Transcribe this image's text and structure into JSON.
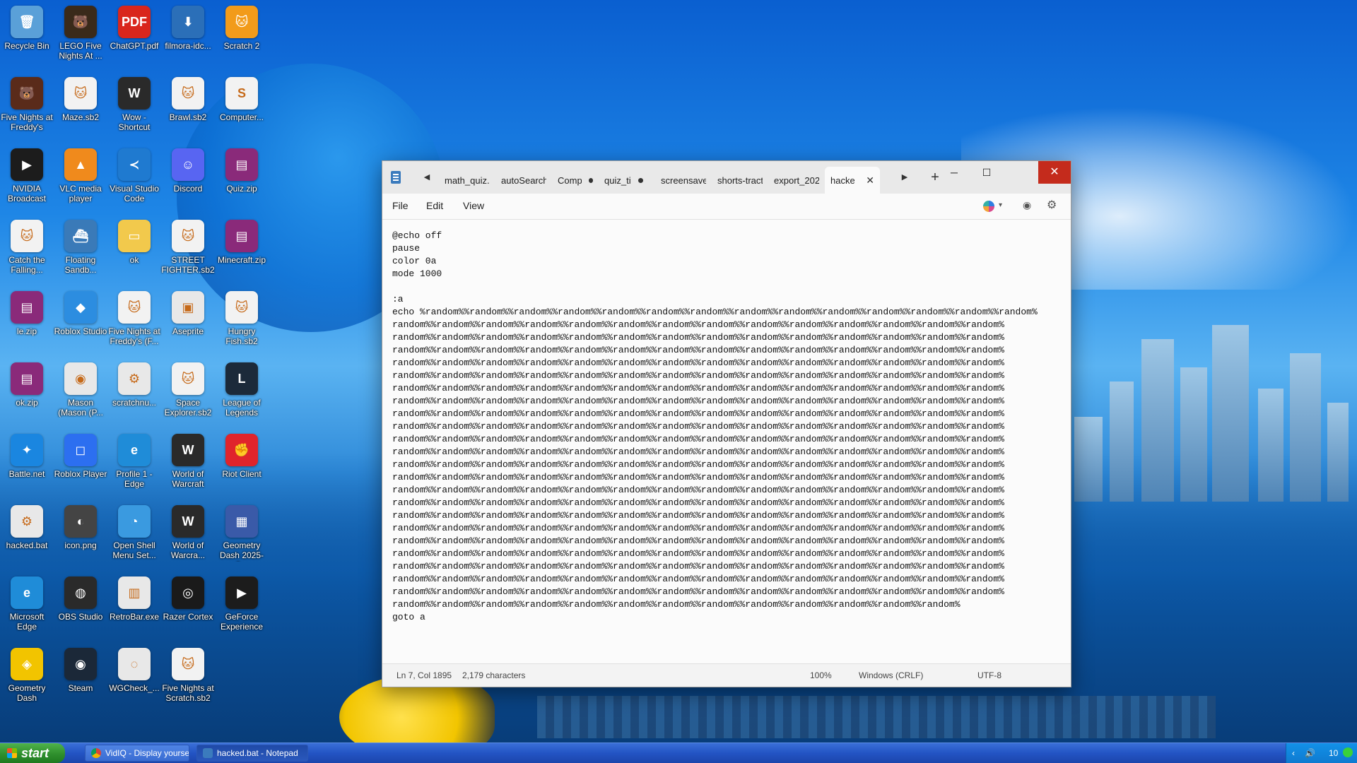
{
  "desktop": {
    "icons": [
      {
        "label": "Recycle Bin",
        "icon": "recycle-bin-icon",
        "color": "#5aa0d8",
        "glyph": "🗑"
      },
      {
        "label": "LEGO Five Nights At ...",
        "icon": "lego-fnaf-icon",
        "color": "#3a2a1a",
        "glyph": "🐻"
      },
      {
        "label": "ChatGPT.pdf",
        "icon": "pdf-file-icon",
        "color": "#d9261c",
        "glyph": "PDF"
      },
      {
        "label": "filmora-idc...",
        "icon": "installer-icon",
        "color": "#2b6fb8",
        "glyph": "⬇"
      },
      {
        "label": "Scratch 2",
        "icon": "scratch-cat-icon",
        "color": "#f29b1a",
        "glyph": "🐱"
      },
      {
        "label": "Five Nights at Freddy's",
        "icon": "fnaf-icon",
        "color": "#5a2b1a",
        "glyph": "🐻"
      },
      {
        "label": "Maze.sb2",
        "icon": "scratch-file-icon",
        "color": "#f2f2f2",
        "glyph": "🐱"
      },
      {
        "label": "Wow - Shortcut",
        "icon": "wow-icon",
        "color": "#2a2a2a",
        "glyph": "W"
      },
      {
        "label": "Brawl.sb2",
        "icon": "scratch-file-icon",
        "color": "#f2f2f2",
        "glyph": "🐱"
      },
      {
        "label": "Computer...",
        "icon": "computer-file-icon",
        "color": "#f2f2f2",
        "glyph": "S"
      },
      {
        "label": "NVIDIA Broadcast",
        "icon": "nvidia-broadcast-icon",
        "color": "#1c1c1c",
        "glyph": "▶"
      },
      {
        "label": "VLC media player",
        "icon": "vlc-icon",
        "color": "#f08a1c",
        "glyph": "▲"
      },
      {
        "label": "Visual Studio Code",
        "icon": "vscode-icon",
        "color": "#1f7ad0",
        "glyph": "≺"
      },
      {
        "label": "Discord",
        "icon": "discord-icon",
        "color": "#5865f2",
        "glyph": "☺"
      },
      {
        "label": "Quiz.zip",
        "icon": "winrar-icon",
        "color": "#8a2a7a",
        "glyph": "▤"
      },
      {
        "label": "Catch the Falling...",
        "icon": "scratch-file-icon",
        "color": "#f2f2f2",
        "glyph": "🐱"
      },
      {
        "label": "Floating Sandb...",
        "icon": "boat-icon",
        "color": "#3a7ab8",
        "glyph": "⛴"
      },
      {
        "label": "ok",
        "icon": "folder-icon",
        "color": "#f2c94c",
        "glyph": "▭"
      },
      {
        "label": "STREET FIGHTER.sb2",
        "icon": "scratch-file-icon",
        "color": "#f2f2f2",
        "glyph": "🐱"
      },
      {
        "label": "Minecraft.zip",
        "icon": "winrar-icon",
        "color": "#8a2a7a",
        "glyph": "▤"
      },
      {
        "label": "le.zip",
        "icon": "winrar-icon",
        "color": "#8a2a7a",
        "glyph": "▤"
      },
      {
        "label": "Roblox Studio",
        "icon": "roblox-studio-icon",
        "color": "#2c8de0",
        "glyph": "◆"
      },
      {
        "label": "Five Nights at Freddy's (F...",
        "icon": "scratch-file-icon",
        "color": "#f2f2f2",
        "glyph": "🐱"
      },
      {
        "label": "Aseprite",
        "icon": "aseprite-icon",
        "color": "#e8e8e8",
        "glyph": "▣"
      },
      {
        "label": "Hungry Fish.sb2",
        "icon": "scratch-file-icon",
        "color": "#f2f2f2",
        "glyph": "🐱"
      },
      {
        "label": "ok.zip",
        "icon": "winrar-icon",
        "color": "#8a2a7a",
        "glyph": "▤"
      },
      {
        "label": "Mason (Mason (P...",
        "icon": "chrome-icon",
        "color": "#e8e8e8",
        "glyph": "◉"
      },
      {
        "label": "scratchnu...",
        "icon": "settings-file-icon",
        "color": "#e8e8e8",
        "glyph": "⚙"
      },
      {
        "label": "Space Explorer.sb2",
        "icon": "scratch-file-icon",
        "color": "#f2f2f2",
        "glyph": "🐱"
      },
      {
        "label": "League of Legends",
        "icon": "league-icon",
        "color": "#1c2a3a",
        "glyph": "L"
      },
      {
        "label": "Battle.net",
        "icon": "battlenet-icon",
        "color": "#1a86e0",
        "glyph": "✦"
      },
      {
        "label": "Roblox Player",
        "icon": "roblox-player-icon",
        "color": "#2c6ff0",
        "glyph": "◻"
      },
      {
        "label": "Profile 1 - Edge",
        "icon": "edge-icon",
        "color": "#1f8cd8",
        "glyph": "e"
      },
      {
        "label": "World of Warcraft",
        "icon": "wow-icon",
        "color": "#2a2a2a",
        "glyph": "W"
      },
      {
        "label": "Riot Client",
        "icon": "riot-icon",
        "color": "#e0242c",
        "glyph": "✊"
      },
      {
        "label": "hacked.bat",
        "icon": "batch-file-icon",
        "color": "#e8e8e8",
        "glyph": "⚙"
      },
      {
        "label": "icon.png",
        "icon": "image-file-icon",
        "color": "#444444",
        "glyph": "◐"
      },
      {
        "label": "Open Shell Menu Set...",
        "icon": "openshell-icon",
        "color": "#3a9ae0",
        "glyph": "◔"
      },
      {
        "label": "World of Warcra...",
        "icon": "wow-icon",
        "color": "#2a2a2a",
        "glyph": "W"
      },
      {
        "label": "Geometry Dash 2025-0...",
        "icon": "geometry-dash-icon",
        "color": "#3a5aa8",
        "glyph": "▦"
      },
      {
        "label": "Microsoft Edge",
        "icon": "edge-icon",
        "color": "#1f8cd8",
        "glyph": "e"
      },
      {
        "label": "OBS Studio",
        "icon": "obs-icon",
        "color": "#2a2a2a",
        "glyph": "◍"
      },
      {
        "label": "RetroBar.exe",
        "icon": "retrobar-icon",
        "color": "#e8e8e8",
        "glyph": "▥"
      },
      {
        "label": "Razer Cortex",
        "icon": "razer-icon",
        "color": "#1a1a1a",
        "glyph": "◎"
      },
      {
        "label": "GeForce Experience",
        "icon": "geforce-icon",
        "color": "#1c1c1c",
        "glyph": "▶"
      },
      {
        "label": "Geometry Dash",
        "icon": "geometry-dash-icon",
        "color": "#f2c400",
        "glyph": "◈"
      },
      {
        "label": "Steam",
        "icon": "steam-icon",
        "color": "#1b2838",
        "glyph": "◉"
      },
      {
        "label": "WGCheck_...",
        "icon": "wgcheck-icon",
        "color": "#e8e8e8",
        "glyph": "◌"
      },
      {
        "label": "Five Nights at Scratch.sb2",
        "icon": "scratch-file-icon",
        "color": "#f2f2f2",
        "glyph": "🐱"
      }
    ]
  },
  "notepad": {
    "tabs": [
      {
        "label": "math_quiz.h",
        "modified": false,
        "active": false
      },
      {
        "label": "autoSearch.l",
        "modified": false,
        "active": false
      },
      {
        "label": "Compi",
        "modified": true,
        "active": false
      },
      {
        "label": "quiz_ti",
        "modified": true,
        "active": false
      },
      {
        "label": "screensaver.",
        "modified": false,
        "active": false
      },
      {
        "label": "shorts-tracti",
        "modified": false,
        "active": false
      },
      {
        "label": "export_2025",
        "modified": false,
        "active": false
      },
      {
        "label": "hacke",
        "modified": false,
        "active": true
      }
    ],
    "new_tab_glyph": "+",
    "window_controls": {
      "minimize": "─",
      "maximize": "☐",
      "close": "✕"
    },
    "menu": {
      "file": "File",
      "edit": "Edit",
      "view": "View"
    },
    "content": "@echo off\npause\ncolor 0a\nmode 1000\n\n:a\necho %random%%random%%random%%random%%random%%random%%random%%random%%random%%random%%random%%random%%random%%random%\nrandom%%random%%random%%random%%random%%random%%random%%random%%random%%random%%random%%random%%random%%random%\nrandom%%random%%random%%random%%random%%random%%random%%random%%random%%random%%random%%random%%random%%random%\nrandom%%random%%random%%random%%random%%random%%random%%random%%random%%random%%random%%random%%random%%random%\nrandom%%random%%random%%random%%random%%random%%random%%random%%random%%random%%random%%random%%random%%random%\nrandom%%random%%random%%random%%random%%random%%random%%random%%random%%random%%random%%random%%random%%random%\nrandom%%random%%random%%random%%random%%random%%random%%random%%random%%random%%random%%random%%random%%random%\nrandom%%random%%random%%random%%random%%random%%random%%random%%random%%random%%random%%random%%random%%random%\nrandom%%random%%random%%random%%random%%random%%random%%random%%random%%random%%random%%random%%random%%random%\nrandom%%random%%random%%random%%random%%random%%random%%random%%random%%random%%random%%random%%random%%random%\nrandom%%random%%random%%random%%random%%random%%random%%random%%random%%random%%random%%random%%random%%random%\nrandom%%random%%random%%random%%random%%random%%random%%random%%random%%random%%random%%random%%random%%random%\nrandom%%random%%random%%random%%random%%random%%random%%random%%random%%random%%random%%random%%random%%random%\nrandom%%random%%random%%random%%random%%random%%random%%random%%random%%random%%random%%random%%random%%random%\nrandom%%random%%random%%random%%random%%random%%random%%random%%random%%random%%random%%random%%random%%random%\nrandom%%random%%random%%random%%random%%random%%random%%random%%random%%random%%random%%random%%random%%random%\nrandom%%random%%random%%random%%random%%random%%random%%random%%random%%random%%random%%random%%random%%random%\nrandom%%random%%random%%random%%random%%random%%random%%random%%random%%random%%random%%random%%random%%random%\nrandom%%random%%random%%random%%random%%random%%random%%random%%random%%random%%random%%random%%random%%random%\nrandom%%random%%random%%random%%random%%random%%random%%random%%random%%random%%random%%random%%random%%random%\nrandom%%random%%random%%random%%random%%random%%random%%random%%random%%random%%random%%random%%random%%random%\nrandom%%random%%random%%random%%random%%random%%random%%random%%random%%random%%random%%random%%random%%random%\nrandom%%random%%random%%random%%random%%random%%random%%random%%random%%random%%random%%random%%random%%random%\nrandom%%random%%random%%random%%random%%random%%random%%random%%random%%random%%random%%random%%random%\ngoto a",
    "status": {
      "position": "Ln 7, Col 1895",
      "chars": "2,179 characters",
      "zoom": "100%",
      "line_ending": "Windows (CRLF)",
      "encoding": "UTF-8"
    }
  },
  "taskbar": {
    "start_label": "start",
    "buttons": [
      {
        "label": "VidIQ - Display yourself...",
        "icon": "chrome-icon",
        "active": false
      },
      {
        "label": "hacked.bat - Notepad",
        "icon": "notepad-icon",
        "active": true
      }
    ],
    "clock": "10"
  },
  "colors": {
    "close_button": "#c42b1c",
    "taskbar": "#2354c4",
    "start_button": "#2f8f2d"
  }
}
